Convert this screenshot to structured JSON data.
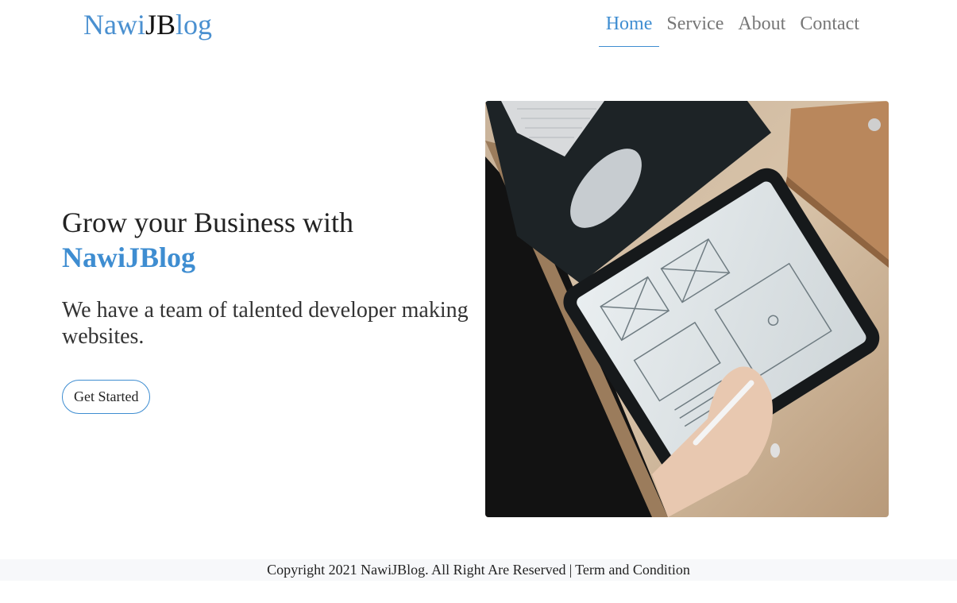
{
  "brand": {
    "part1": "Nawi",
    "part2": "JB",
    "part3": "log"
  },
  "nav": {
    "items": [
      {
        "label": "Home"
      },
      {
        "label": "Service"
      },
      {
        "label": "About"
      },
      {
        "label": "Contact"
      }
    ],
    "active": "Home"
  },
  "hero": {
    "title_line1": "Grow your Business with",
    "title_accent": "NawiJBlog",
    "subtitle": "We have a team of talented developer making websites.",
    "cta_label": "Get Started"
  },
  "footer": {
    "copyright": "Copyright 2021 NawiJBlog. All Right Are Reserved",
    "separator": "|",
    "terms_label": "Term and Condition"
  },
  "colors": {
    "accent": "#3e8dd1",
    "nav_text": "#777777",
    "footer_bg": "#f7f8fa"
  }
}
